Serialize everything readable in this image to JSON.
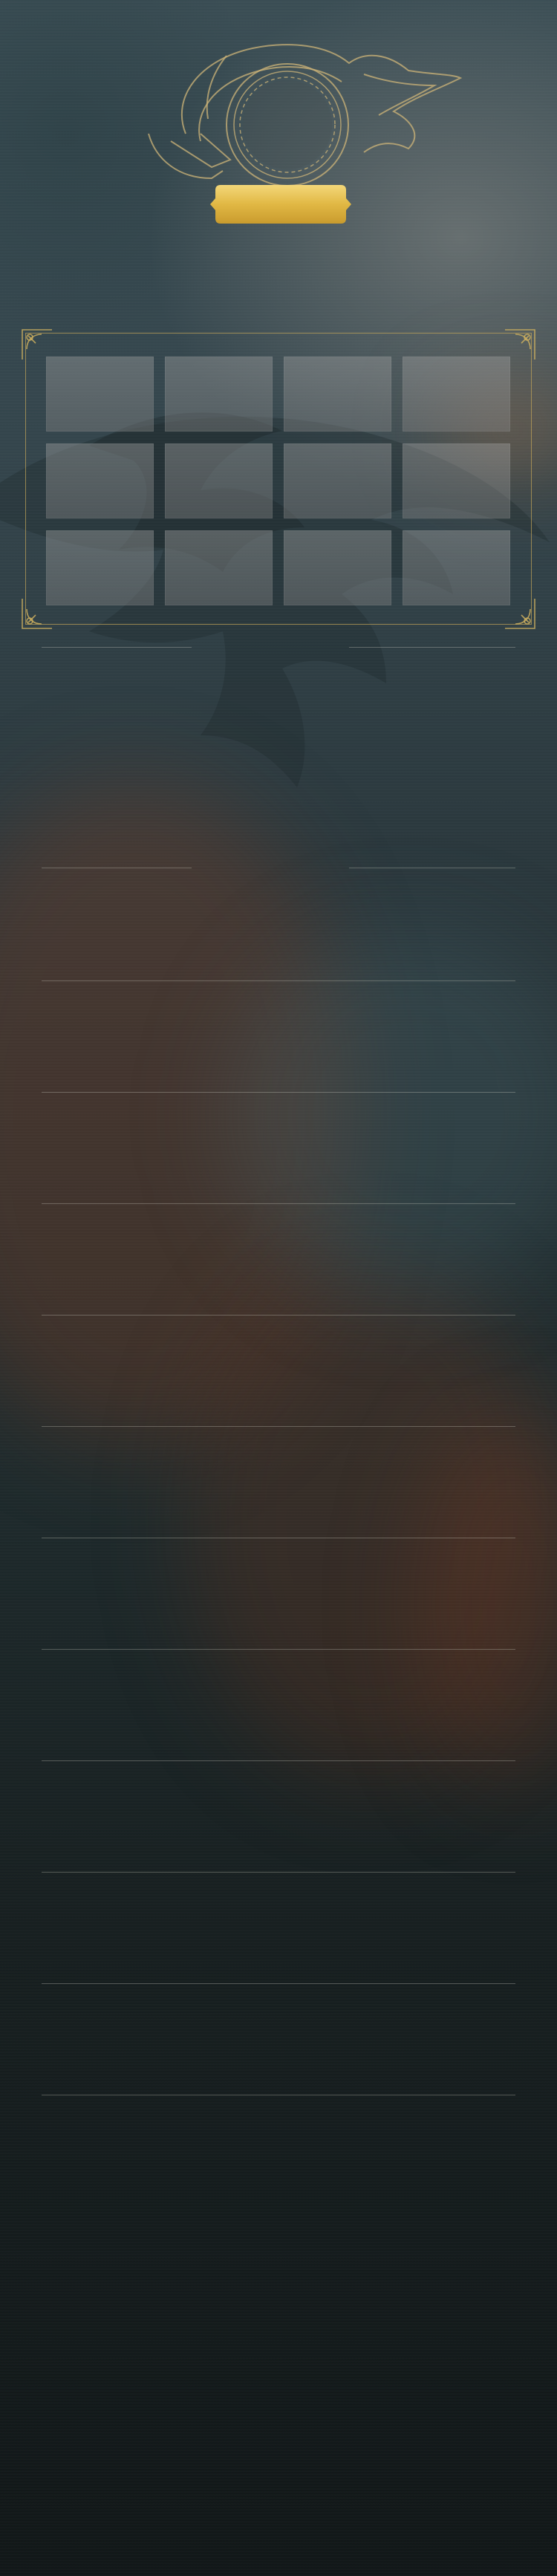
{
  "profile": {
    "name": ""
  },
  "colors": {
    "gold_accent": "#c4a65a",
    "nameplate_gold": "#e7c45a",
    "tile_fill": "#8c8c8c",
    "background_top": "#3a4d54",
    "background_bottom": "#111718"
  },
  "icons": {
    "avatar_frame": "flaming-ring-emblem",
    "frame_corner": "ornate-corner",
    "background_emblem": "stylized-bird-crest"
  },
  "grid": {
    "rows": 3,
    "columns": 4,
    "tiles": [
      "",
      "",
      "",
      "",
      "",
      "",
      "",
      "",
      "",
      "",
      "",
      ""
    ]
  },
  "sections": [
    "",
    "",
    "",
    "",
    "",
    "",
    "",
    "",
    "",
    "",
    "",
    ""
  ]
}
